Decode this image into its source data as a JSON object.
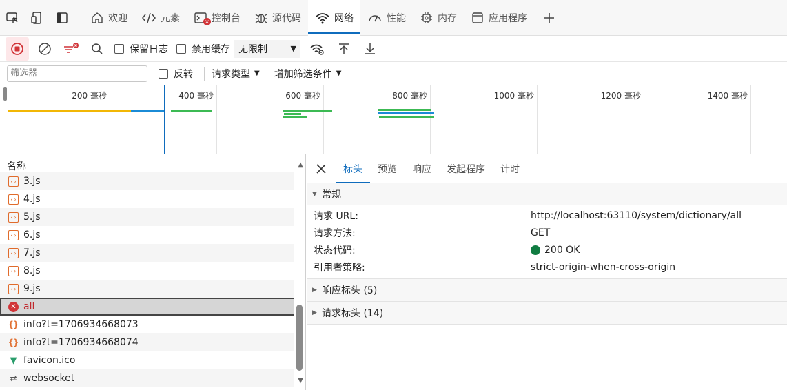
{
  "tabs": [
    {
      "label": "欢迎",
      "icon": "home-icon"
    },
    {
      "label": "元素",
      "icon": "code-icon"
    },
    {
      "label": "控制台",
      "icon": "console-icon"
    },
    {
      "label": "源代码",
      "icon": "bug-icon"
    },
    {
      "label": "网络",
      "icon": "wifi-icon"
    },
    {
      "label": "性能",
      "icon": "gauge-icon"
    },
    {
      "label": "内存",
      "icon": "chip-icon"
    },
    {
      "label": "应用程序",
      "icon": "app-window-icon"
    }
  ],
  "console_error_badge": "×",
  "toolbar": {
    "preserve_log": "保留日志",
    "disable_cache": "禁用缓存",
    "throttle": "无限制"
  },
  "filter": {
    "placeholder": "筛选器",
    "invert": "反转",
    "request_types": "请求类型",
    "add_filter": "增加筛选条件"
  },
  "timeline": {
    "ticks": [
      "200 毫秒",
      "400 毫秒",
      "600 毫秒",
      "800 毫秒",
      "1000 毫秒",
      "1200 毫秒",
      "1400 毫秒"
    ]
  },
  "request_list": {
    "header": "名称",
    "rows": [
      {
        "name": "3.js",
        "type": "js"
      },
      {
        "name": "4.js",
        "type": "js"
      },
      {
        "name": "5.js",
        "type": "js"
      },
      {
        "name": "6.js",
        "type": "js"
      },
      {
        "name": "7.js",
        "type": "js"
      },
      {
        "name": "8.js",
        "type": "js"
      },
      {
        "name": "9.js",
        "type": "js"
      },
      {
        "name": "all",
        "type": "error"
      },
      {
        "name": "info?t=1706934668073",
        "type": "json"
      },
      {
        "name": "info?t=1706934668074",
        "type": "json"
      },
      {
        "name": "favicon.ico",
        "type": "vue"
      },
      {
        "name": "websocket",
        "type": "ws"
      }
    ]
  },
  "details": {
    "tabs": [
      "标头",
      "预览",
      "响应",
      "发起程序",
      "计时"
    ],
    "general_title": "常规",
    "fields": {
      "url_label": "请求 URL:",
      "url_value": "http://localhost:63110/system/dictionary/all",
      "method_label": "请求方法:",
      "method_value": "GET",
      "status_label": "状态代码:",
      "status_value": "200 OK",
      "referrer_label": "引用者策略:",
      "referrer_value": "strict-origin-when-cross-origin"
    },
    "response_headers": "响应标头 (5)",
    "request_headers": "请求标头 (14)"
  },
  "colors": {
    "accent": "#0f6cbd",
    "error": "#d13438",
    "success": "#107c41"
  }
}
